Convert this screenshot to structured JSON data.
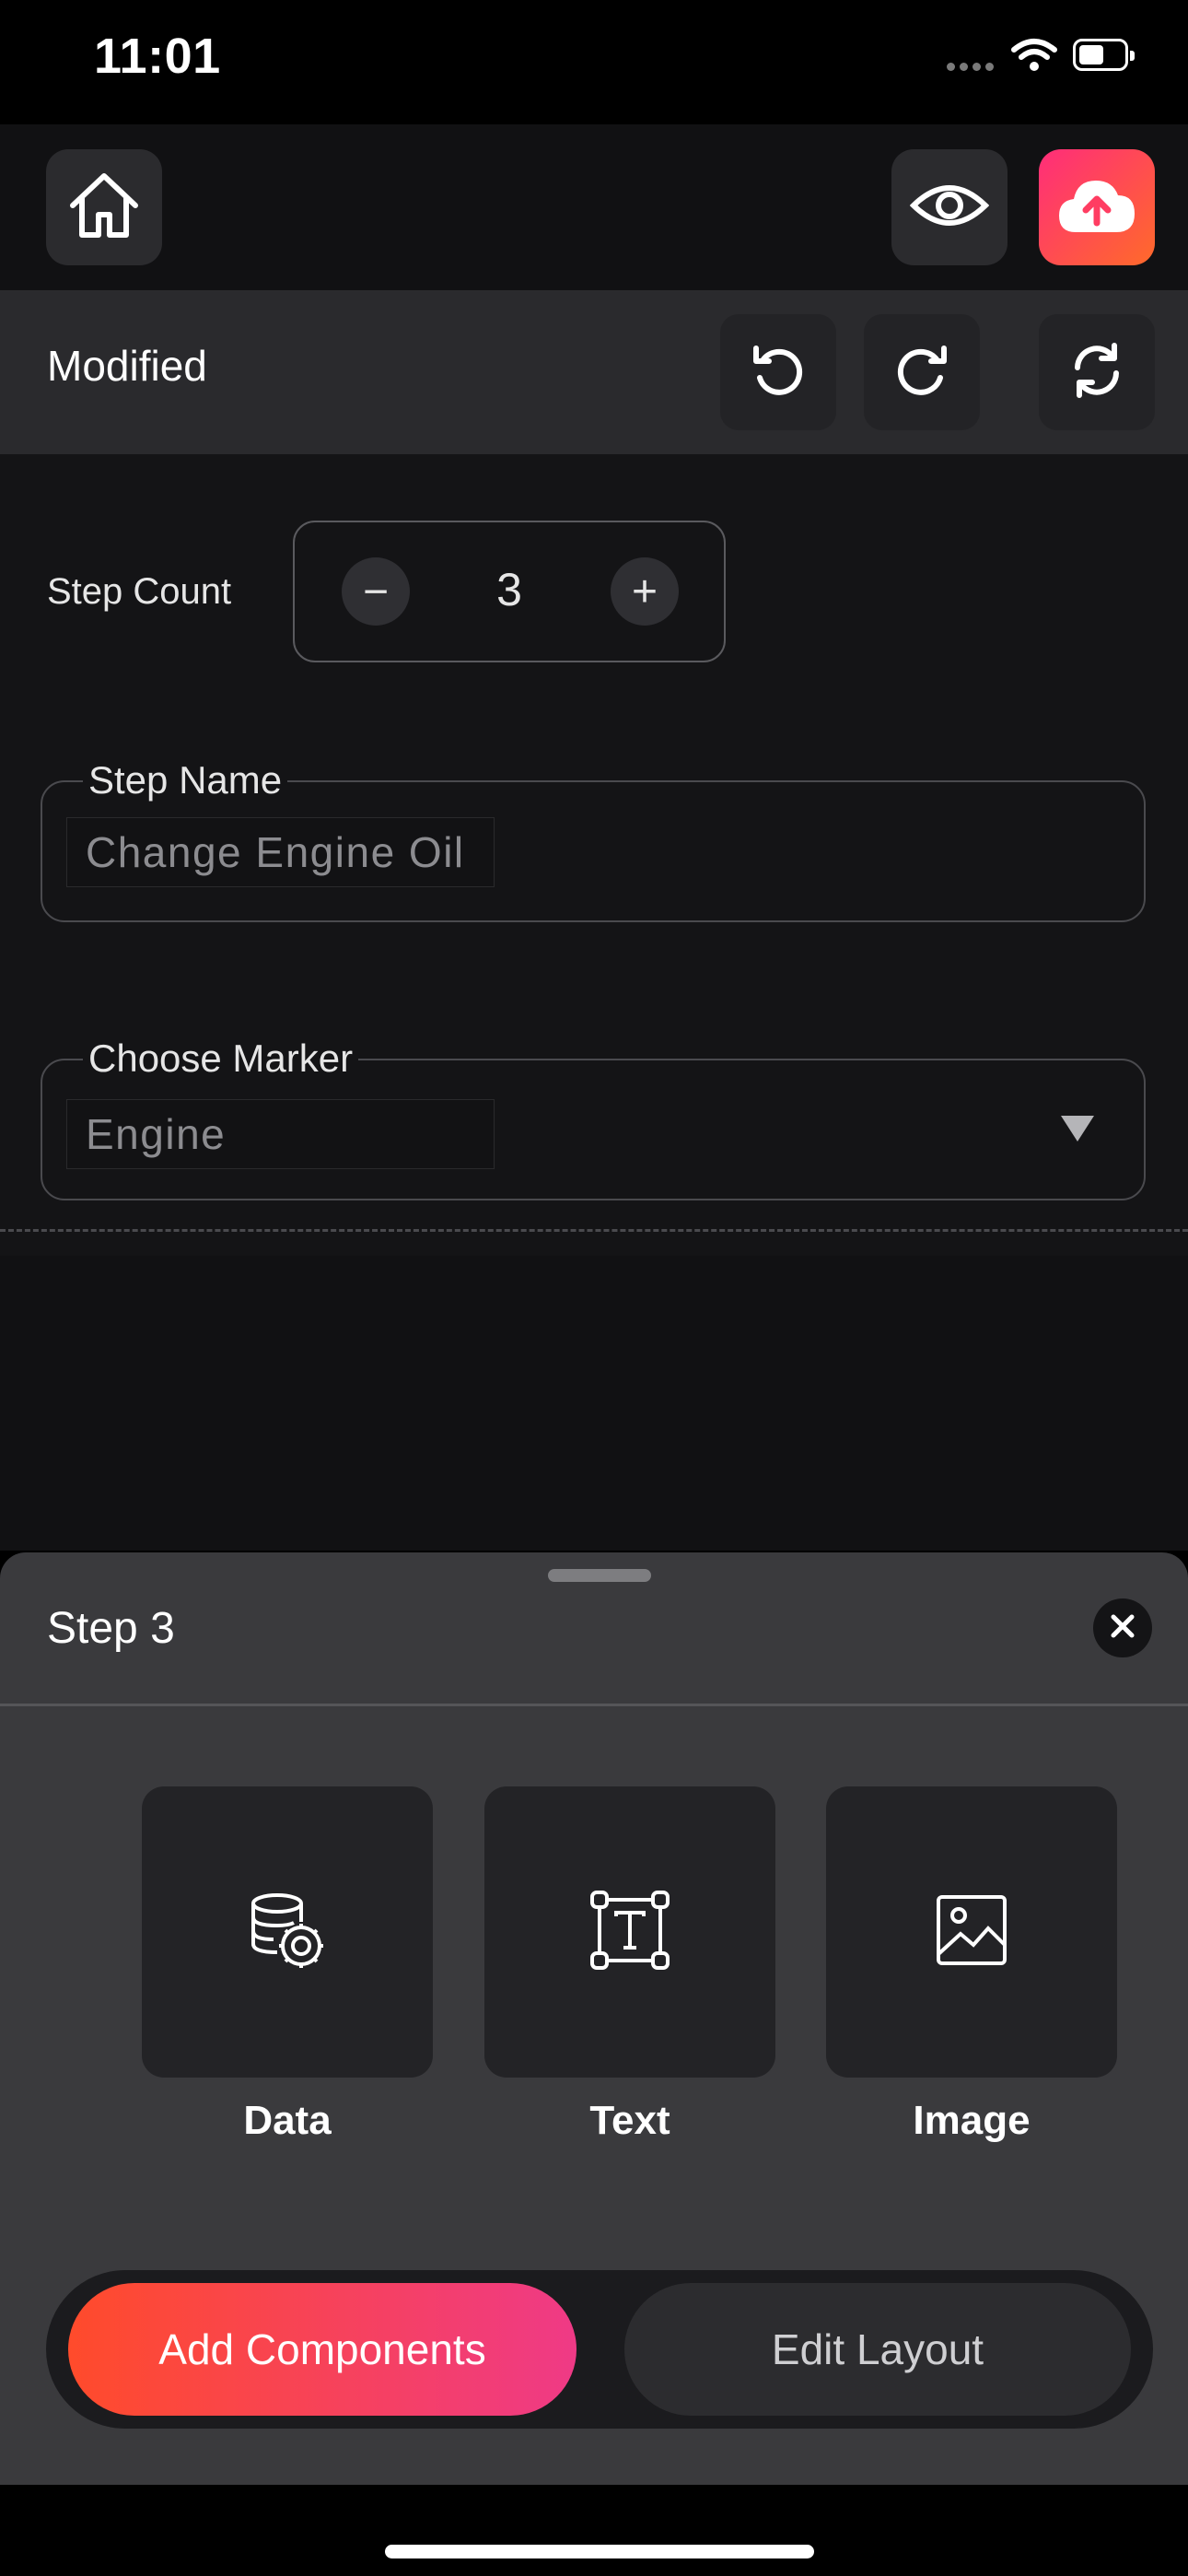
{
  "status_bar": {
    "time": "11:01"
  },
  "toolbar": {
    "home_icon": "home-icon",
    "preview_icon": "eye-icon",
    "upload_icon": "cloud-upload-icon",
    "upload_gradient": [
      "#ff2d7a",
      "#ff6a2a"
    ]
  },
  "modified_bar": {
    "label": "Modified",
    "undo_icon": "undo-icon",
    "redo_icon": "redo-icon",
    "refresh_icon": "refresh-icon"
  },
  "step_count": {
    "label": "Step Count",
    "value": "3",
    "minus": "−",
    "plus": "+"
  },
  "step_name": {
    "legend": "Step Name",
    "value": "Change Engine Oil"
  },
  "marker": {
    "legend": "Choose Marker",
    "value": "Engine"
  },
  "sheet": {
    "title": "Step 3",
    "close_icon": "close-icon",
    "tiles": [
      {
        "label": "Data",
        "icon": "database-gear-icon"
      },
      {
        "label": "Text",
        "icon": "text-box-icon"
      },
      {
        "label": "Image",
        "icon": "image-icon"
      }
    ],
    "segments": {
      "add": "Add Components",
      "edit": "Edit Layout",
      "selected": "Add Components"
    },
    "accent_gradient": [
      "#ff4b2b",
      "#ef3a86"
    ]
  }
}
